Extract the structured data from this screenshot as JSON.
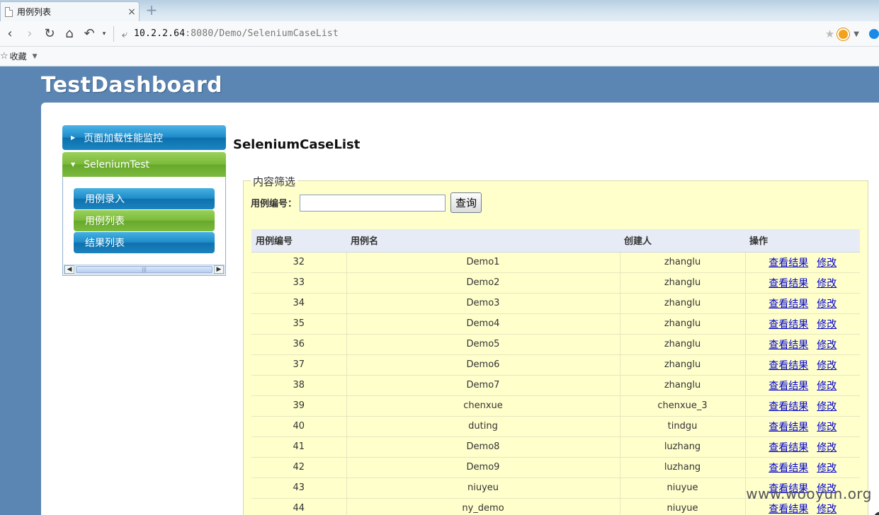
{
  "browser": {
    "tab_title": "用例列表",
    "tab_close": "×",
    "new_tab": "+",
    "url_host": "10.2.2.64",
    "url_rest": ":8080/Demo/SeleniumCaseList",
    "favorites_label": "收藏"
  },
  "page": {
    "title": "TestDashboard",
    "heading": "SeleniumCaseList"
  },
  "sidebar": {
    "sections": [
      {
        "label": "页面加载性能监控",
        "expanded": false
      },
      {
        "label": "SeleniumTest",
        "expanded": true
      }
    ],
    "items": [
      {
        "label": "用例录入",
        "active": false
      },
      {
        "label": "用例列表",
        "active": true
      },
      {
        "label": "结果列表",
        "active": false
      }
    ]
  },
  "filter": {
    "legend": "内容筛选",
    "label": "用例编号：",
    "input_value": "",
    "query_button": "查询"
  },
  "table": {
    "headers": [
      "用例编号",
      "用例名",
      "创建人",
      "操作"
    ],
    "action_view": "查看结果",
    "action_edit": "修改",
    "rows": [
      {
        "id": "32",
        "name": "Demo1",
        "creator": "zhanglu"
      },
      {
        "id": "33",
        "name": "Demo2",
        "creator": "zhanglu"
      },
      {
        "id": "34",
        "name": "Demo3",
        "creator": "zhanglu"
      },
      {
        "id": "35",
        "name": "Demo4",
        "creator": "zhanglu"
      },
      {
        "id": "36",
        "name": "Demo5",
        "creator": "zhanglu"
      },
      {
        "id": "37",
        "name": "Demo6",
        "creator": "zhanglu"
      },
      {
        "id": "38",
        "name": "Demo7",
        "creator": "zhanglu"
      },
      {
        "id": "39",
        "name": "chenxue",
        "creator": "chenxue_3"
      },
      {
        "id": "40",
        "name": "duting",
        "creator": "tindgu"
      },
      {
        "id": "41",
        "name": "Demo8",
        "creator": "luzhang"
      },
      {
        "id": "42",
        "name": "Demo9",
        "creator": "luzhang"
      },
      {
        "id": "43",
        "name": "niuyeu",
        "creator": "niuyue"
      },
      {
        "id": "44",
        "name": "ny_demo",
        "creator": "niuyue"
      }
    ]
  },
  "watermark": "www.wooyun.org"
}
